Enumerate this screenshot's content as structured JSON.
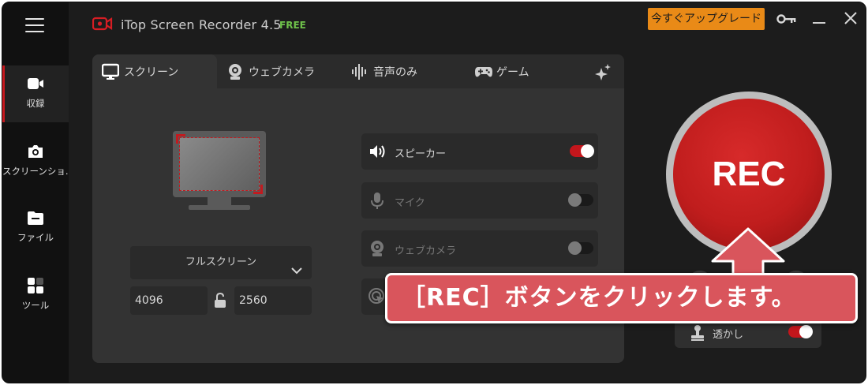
{
  "app": {
    "title": "iTop Screen Recorder 4.5",
    "badge": "FREE",
    "upgrade_label": "今すぐアップグレード"
  },
  "sidebar": {
    "items": [
      {
        "label": "収録",
        "icon": "video-camera-icon",
        "active": true
      },
      {
        "label": "スクリーンショ...",
        "icon": "camera-icon",
        "active": false
      },
      {
        "label": "ファイル",
        "icon": "folder-icon",
        "active": false
      },
      {
        "label": "ツール",
        "icon": "grid-icon",
        "active": false
      }
    ]
  },
  "tabs": [
    {
      "label": "スクリーン",
      "icon": "monitor-icon",
      "active": true
    },
    {
      "label": "ウェブカメラ",
      "icon": "webcam-icon",
      "active": false
    },
    {
      "label": "音声のみ",
      "icon": "waveform-icon",
      "active": false
    },
    {
      "label": "ゲーム",
      "icon": "gamepad-icon",
      "active": false
    },
    {
      "label": "",
      "icon": "sparkle-icon",
      "active": false
    }
  ],
  "screen": {
    "mode": "フルスクリーン",
    "width": "4096",
    "height": "2560"
  },
  "options": [
    {
      "label": "スピーカー",
      "icon": "speaker-icon",
      "enabled": true
    },
    {
      "label": "マイク",
      "icon": "microphone-icon",
      "enabled": false
    },
    {
      "label": "ウェブカメラ",
      "icon": "webcam-icon",
      "enabled": false
    }
  ],
  "rec": {
    "label": "REC",
    "watermark_label": "透かし",
    "watermark_enabled": true
  },
  "annotation": {
    "text": "［REC］ボタンをクリックします。"
  },
  "colors": {
    "accent": "#c3161c",
    "upgrade": "#e98a17",
    "free": "#6ec14a",
    "callout": "#d9555c"
  }
}
